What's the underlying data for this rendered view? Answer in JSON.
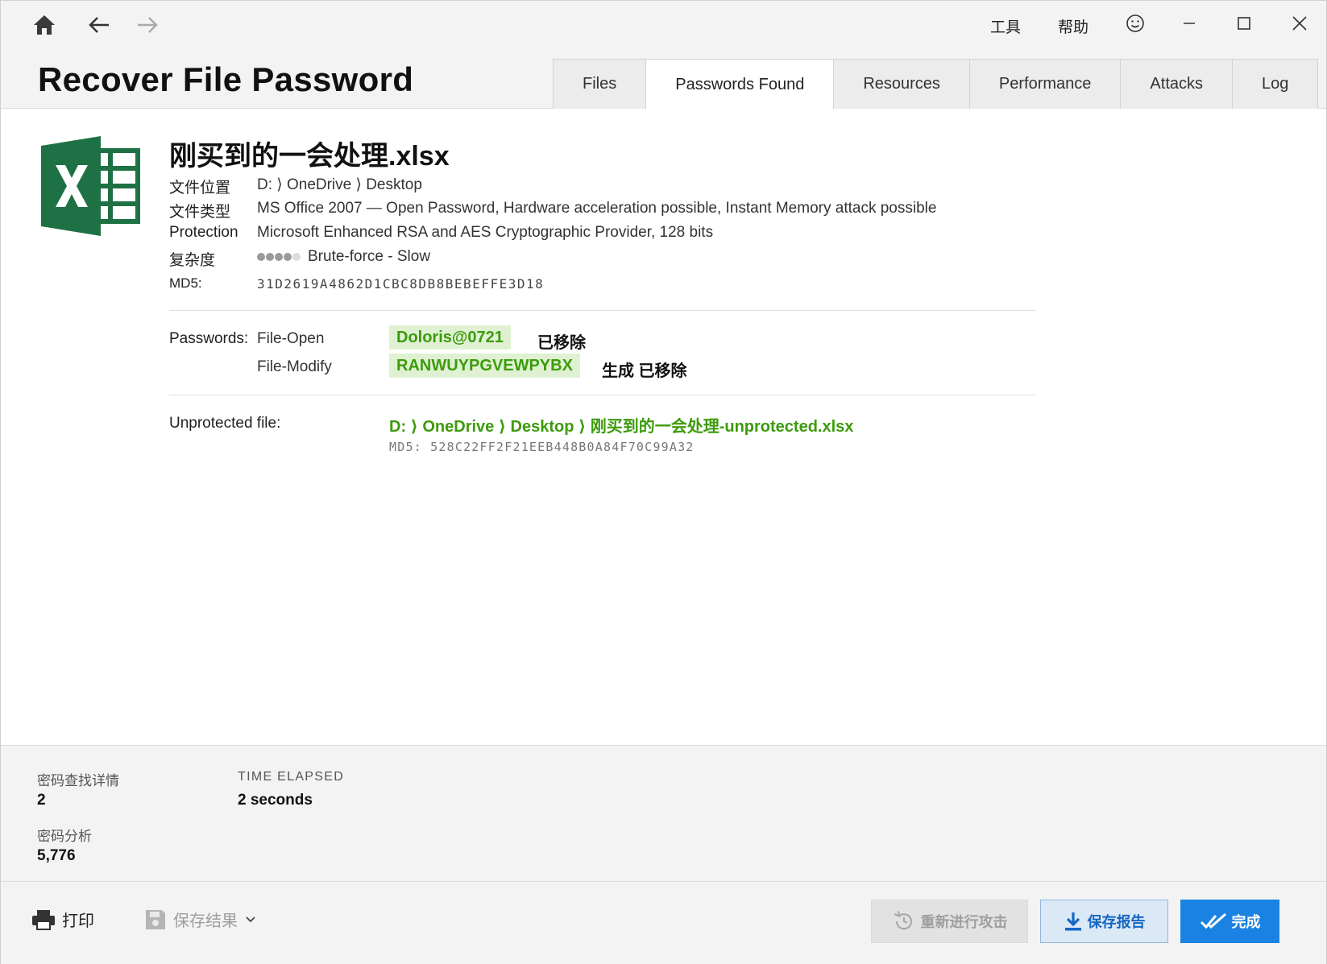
{
  "app": {
    "title": "Recover File Password"
  },
  "menu": {
    "tools": "工具",
    "help": "帮助"
  },
  "tabs": [
    {
      "label": "Files",
      "active": false
    },
    {
      "label": "Passwords Found",
      "active": true
    },
    {
      "label": "Resources",
      "active": false
    },
    {
      "label": "Performance",
      "active": false
    },
    {
      "label": "Attacks",
      "active": false
    },
    {
      "label": "Log",
      "active": false
    }
  ],
  "file": {
    "icon": "excel-file-icon",
    "name": "刚买到的一会处理.xlsx",
    "location_label": "文件位置",
    "location_value": "D: ⟩ OneDrive ⟩ Desktop",
    "type_label": "文件类型",
    "type_value": "MS Office 2007 — Open Password, Hardware acceleration possible, Instant Memory attack possible",
    "protection_label": "Protection",
    "protection_value": "Microsoft Enhanced RSA and AES Cryptographic Provider, 128 bits",
    "complexity_label": "复杂度",
    "complexity_level": 4,
    "complexity_max": 5,
    "complexity_value": "Brute-force - Slow",
    "md5_label": "MD5:",
    "md5_value": "31D2619A4862D1CBC8DB8BEBEFFE3D18"
  },
  "passwords": {
    "label": "Passwords:",
    "items": [
      {
        "type": "File-Open",
        "value": "Doloris@0721",
        "status": "已移除"
      },
      {
        "type": "File-Modify",
        "value": "RANWUYPGVEWPYBX",
        "status": "生成 已移除"
      }
    ]
  },
  "unprotected": {
    "label": "Unprotected file:",
    "path": "D: ⟩ OneDrive ⟩ Desktop ⟩ 刚买到的一会处理-unprotected.xlsx",
    "md5": "MD5: 528C22FF2F21EEB448B0A84F70C99A32"
  },
  "stats": {
    "found_label": "密码查找详情",
    "found_value": "2",
    "elapsed_label": "TIME ELAPSED",
    "elapsed_value": "2 seconds",
    "analyzed_label": "密码分析",
    "analyzed_value": "5,776"
  },
  "bottom": {
    "print_label": "打印",
    "save_results_label": "保存结果",
    "rerun_label": "重新进行攻击",
    "save_report_label": "保存报告",
    "done_label": "完成"
  },
  "colors": {
    "accent_green": "#3c9b0b",
    "badge_bg": "#dff1d2",
    "primary_blue": "#1a82e2",
    "excel_green": "#1e7145"
  }
}
